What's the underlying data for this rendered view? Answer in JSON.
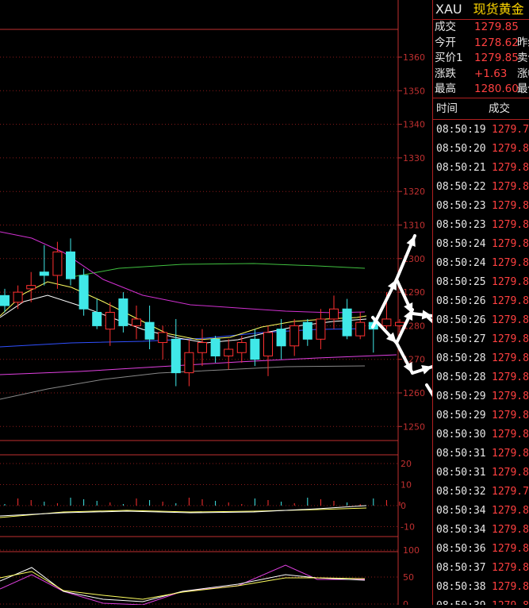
{
  "header": {
    "symbol": "XAU",
    "name": "现货黄金"
  },
  "quote": [
    {
      "label": "成交",
      "value": "1279.85",
      "extra": ""
    },
    {
      "label": "今开",
      "value": "1278.62",
      "extra": "昨结"
    },
    {
      "label": "买价1",
      "value": "1279.85",
      "extra": "卖价"
    },
    {
      "label": "涨跌",
      "value": "+1.63",
      "extra": "涨幅"
    },
    {
      "label": "最高",
      "value": "1280.60",
      "extra": "最低"
    }
  ],
  "trades_header": {
    "time": "时间",
    "price": "成交"
  },
  "trades": [
    {
      "time": "08:50:19",
      "price": "1279.7"
    },
    {
      "time": "08:50:20",
      "price": "1279.8"
    },
    {
      "time": "08:50:21",
      "price": "1279.8"
    },
    {
      "time": "08:50:22",
      "price": "1279.8"
    },
    {
      "time": "08:50:23",
      "price": "1279.8"
    },
    {
      "time": "08:50:23",
      "price": "1279.8"
    },
    {
      "time": "08:50:24",
      "price": "1279.8"
    },
    {
      "time": "08:50:24",
      "price": "1279.8"
    },
    {
      "time": "08:50:25",
      "price": "1279.8"
    },
    {
      "time": "08:50:26",
      "price": "1279.8"
    },
    {
      "time": "08:50:26",
      "price": "1279.8"
    },
    {
      "time": "08:50:27",
      "price": "1279.8"
    },
    {
      "time": "08:50:28",
      "price": "1279.8"
    },
    {
      "time": "08:50:28",
      "price": "1279.8"
    },
    {
      "time": "08:50:29",
      "price": "1279.8"
    },
    {
      "time": "08:50:29",
      "price": "1279.8"
    },
    {
      "time": "08:50:30",
      "price": "1279.8"
    },
    {
      "time": "08:50:31",
      "price": "1279.8"
    },
    {
      "time": "08:50:31",
      "price": "1279.8"
    },
    {
      "time": "08:50:32",
      "price": "1279.7"
    },
    {
      "time": "08:50:34",
      "price": "1279.8"
    },
    {
      "time": "08:50:34",
      "price": "1279.8"
    },
    {
      "time": "08:50:36",
      "price": "1279.8"
    },
    {
      "time": "08:50:37",
      "price": "1279.8"
    },
    {
      "time": "08:50:38",
      "price": "1279.8"
    },
    {
      "time": "08:50:39",
      "price": "1279.8"
    }
  ],
  "colors": {
    "up": "#ff3030",
    "down": "#40e8e8",
    "grid": "#8b1a1a",
    "axis": "#c03030"
  },
  "chart_data": {
    "type": "candlestick",
    "price_axis": {
      "ticks": [
        1360,
        1350,
        1340,
        1330,
        1320,
        1310,
        1300,
        1290,
        1280,
        1270,
        1260,
        1250
      ],
      "range": [
        1245,
        1367
      ]
    },
    "candles": [
      {
        "o": 1289,
        "h": 1291,
        "l": 1284,
        "c": 1286
      },
      {
        "o": 1287,
        "h": 1292,
        "l": 1285,
        "c": 1290
      },
      {
        "o": 1291,
        "h": 1296,
        "l": 1287,
        "c": 1292
      },
      {
        "o": 1296,
        "h": 1304,
        "l": 1292,
        "c": 1295
      },
      {
        "o": 1295,
        "h": 1305,
        "l": 1291,
        "c": 1302
      },
      {
        "o": 1302,
        "h": 1306,
        "l": 1292,
        "c": 1294
      },
      {
        "o": 1295,
        "h": 1297,
        "l": 1283,
        "c": 1285
      },
      {
        "o": 1284,
        "h": 1288,
        "l": 1279,
        "c": 1280
      },
      {
        "o": 1279,
        "h": 1287,
        "l": 1274,
        "c": 1284
      },
      {
        "o": 1288,
        "h": 1290,
        "l": 1278,
        "c": 1280
      },
      {
        "o": 1280,
        "h": 1286,
        "l": 1276,
        "c": 1282
      },
      {
        "o": 1281,
        "h": 1286,
        "l": 1273,
        "c": 1276
      },
      {
        "o": 1275,
        "h": 1280,
        "l": 1270,
        "c": 1278
      },
      {
        "o": 1276,
        "h": 1282,
        "l": 1262,
        "c": 1266
      },
      {
        "o": 1266,
        "h": 1276,
        "l": 1262,
        "c": 1272
      },
      {
        "o": 1272,
        "h": 1279,
        "l": 1268,
        "c": 1275
      },
      {
        "o": 1276,
        "h": 1277,
        "l": 1269,
        "c": 1271
      },
      {
        "o": 1271,
        "h": 1276,
        "l": 1267,
        "c": 1273
      },
      {
        "o": 1272,
        "h": 1277,
        "l": 1269,
        "c": 1275
      },
      {
        "o": 1276,
        "h": 1279,
        "l": 1268,
        "c": 1270
      },
      {
        "o": 1271,
        "h": 1280,
        "l": 1265,
        "c": 1278
      },
      {
        "o": 1279,
        "h": 1282,
        "l": 1270,
        "c": 1274
      },
      {
        "o": 1274,
        "h": 1282,
        "l": 1271,
        "c": 1280
      },
      {
        "o": 1281,
        "h": 1282,
        "l": 1274,
        "c": 1276
      },
      {
        "o": 1276,
        "h": 1285,
        "l": 1273,
        "c": 1282
      },
      {
        "o": 1282,
        "h": 1289,
        "l": 1279,
        "c": 1285
      },
      {
        "o": 1285,
        "h": 1288,
        "l": 1276,
        "c": 1277
      },
      {
        "o": 1277,
        "h": 1284,
        "l": 1276,
        "c": 1281
      },
      {
        "o": 1281,
        "h": 1283,
        "l": 1272,
        "c": 1279
      },
      {
        "o": 1280,
        "h": 1290,
        "l": 1279,
        "c": 1282
      },
      {
        "o": 1280,
        "h": 1282,
        "l": 1278,
        "c": 1281
      }
    ],
    "volume_axis": {
      "ticks": [
        20,
        10,
        0,
        -10
      ]
    },
    "osc_axis": {
      "ticks": [
        100,
        50,
        0
      ]
    }
  }
}
